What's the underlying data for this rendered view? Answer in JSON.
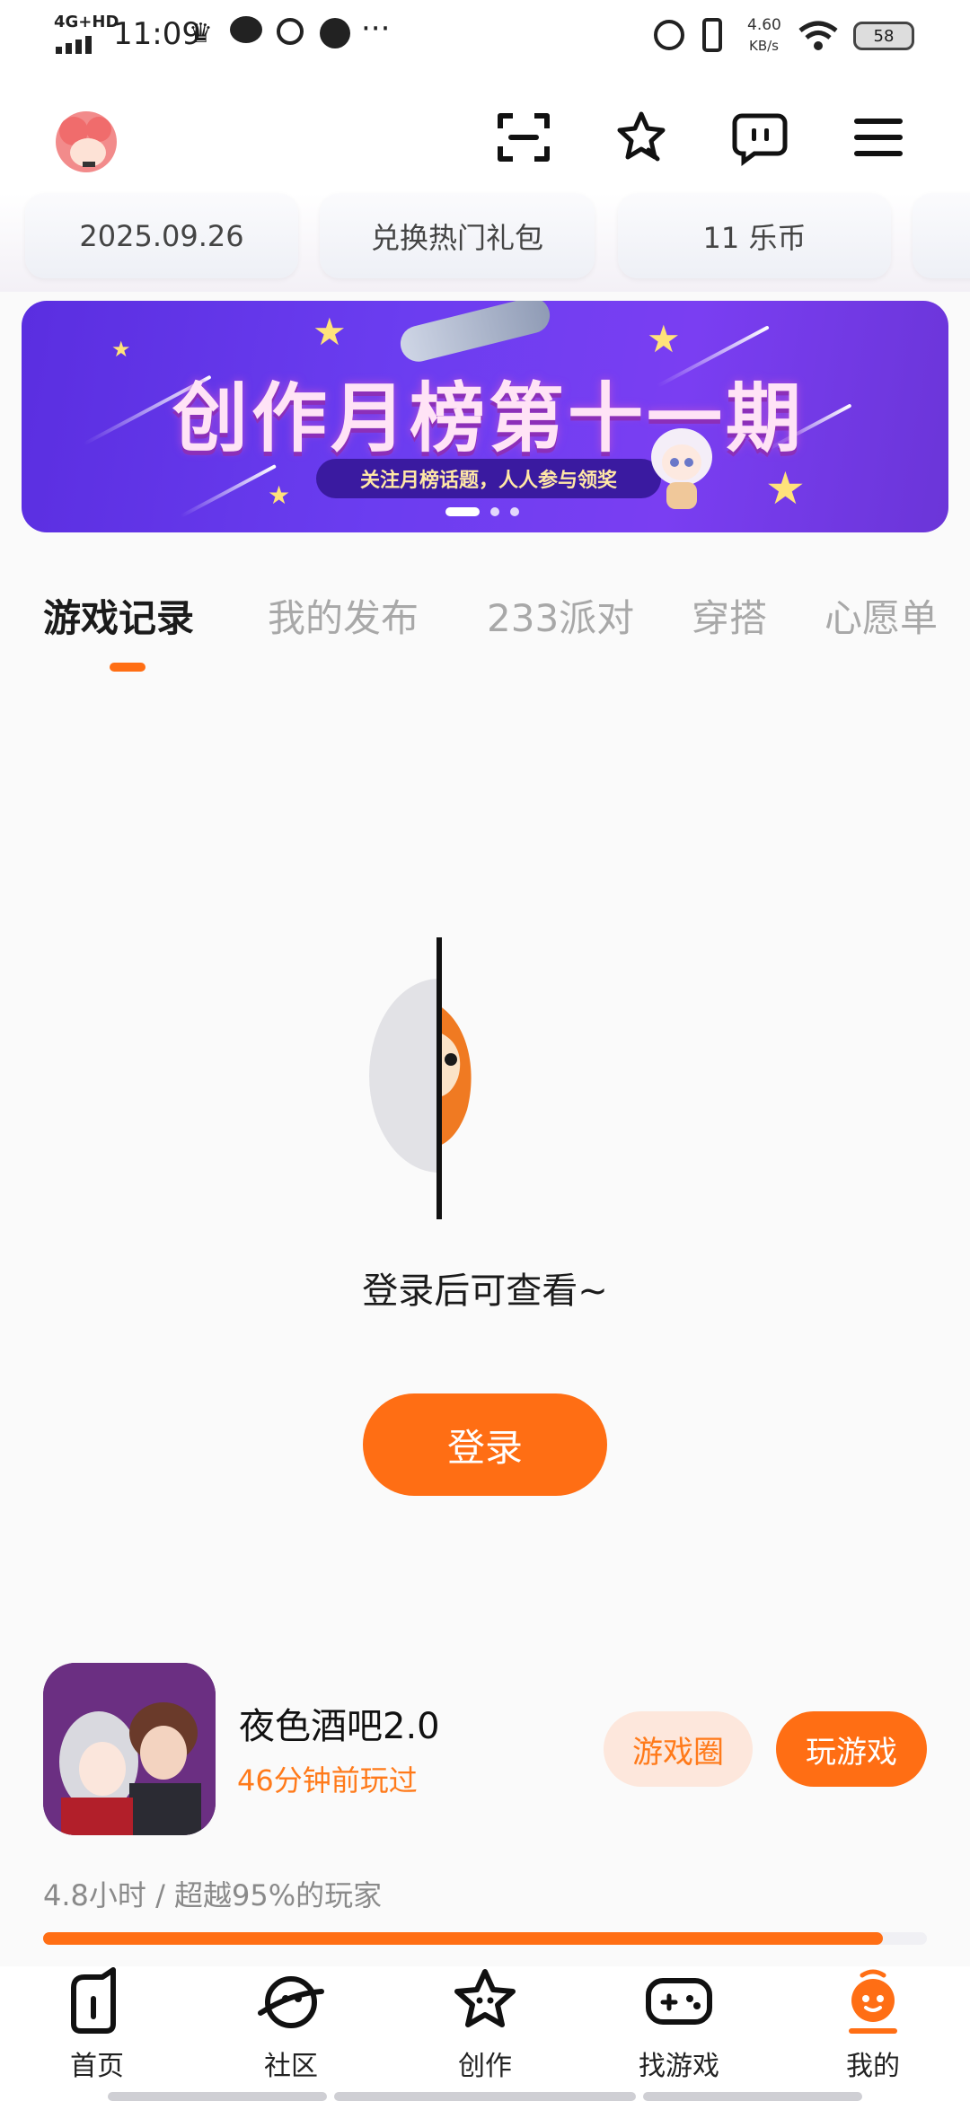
{
  "status_bar": {
    "network": "4G+HD",
    "time": "11:09",
    "speed_value": "4.60",
    "speed_unit": "KB/s",
    "battery": "58"
  },
  "cards": [
    {
      "label": "2025.09.26"
    },
    {
      "label": "兑换热门礼包"
    },
    {
      "label": "11 乐币"
    }
  ],
  "banner": {
    "title": "创作月榜第十一期",
    "subtitle": "关注月榜话题，人人参与领奖"
  },
  "tabs": [
    {
      "label": "游戏记录"
    },
    {
      "label": "我的发布"
    },
    {
      "label": "233派对"
    },
    {
      "label": "穿搭"
    },
    {
      "label": "心愿单"
    }
  ],
  "empty_state": {
    "message": "登录后可查看~",
    "login_label": "登录"
  },
  "recent_game": {
    "name": "夜色酒吧2.0",
    "last_played": "46分钟前玩过",
    "stats": "4.8小时 / 超越95%的玩家",
    "progress": 0.95,
    "circle_label": "游戏圈",
    "play_label": "玩游戏"
  },
  "nav": [
    {
      "label": "首页",
      "icon": "home-icon"
    },
    {
      "label": "社区",
      "icon": "planet-icon"
    },
    {
      "label": "创作",
      "icon": "star-icon"
    },
    {
      "label": "找游戏",
      "icon": "gamepad-icon"
    },
    {
      "label": "我的",
      "icon": "profile-icon"
    }
  ],
  "colors": {
    "accent": "#ff6e14",
    "banner": "#6b3df0"
  }
}
